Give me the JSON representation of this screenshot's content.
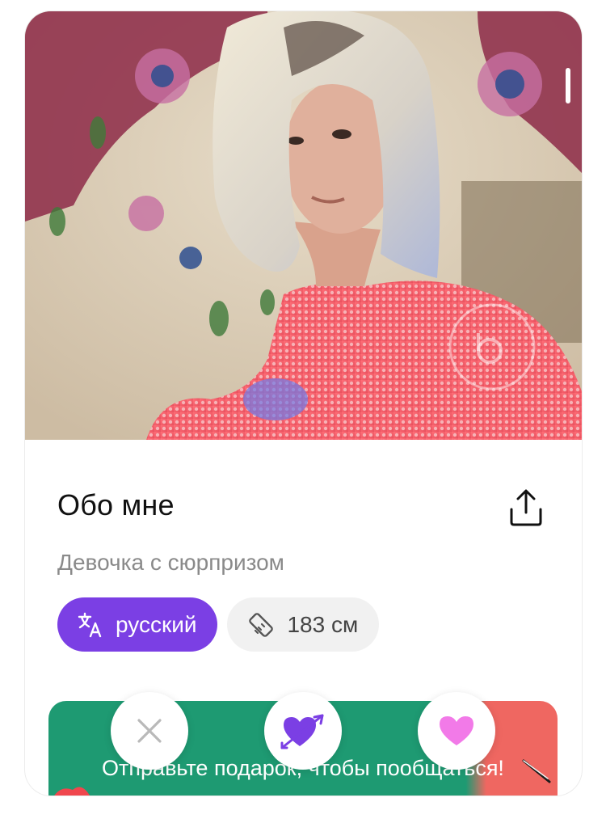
{
  "profile": {
    "about_title": "Обо мне",
    "bio": "Девочка с сюрпризом",
    "chips": {
      "language": "русский",
      "height": "183 см"
    }
  },
  "gift_banner": {
    "text": "Отправьте подарок, чтобы пообщаться!"
  },
  "actions": {
    "dislike_icon": "close-icon",
    "super_like_icon": "heart-arrow-icon",
    "like_icon": "heart-icon"
  },
  "colors": {
    "accent_purple": "#7b3fe4",
    "like_pink": "#f27ae8",
    "banner_green": "#1e9a72",
    "banner_red": "#ef6761",
    "chip_gray": "#f1f1f1"
  }
}
